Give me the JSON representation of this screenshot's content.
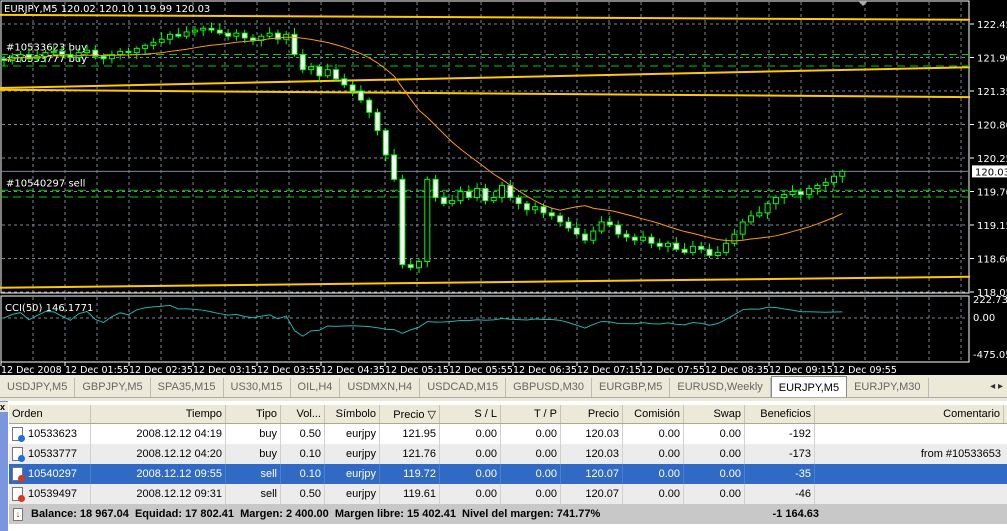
{
  "chart": {
    "title": "EURJPY,M5  120.02 120.10 119.99 120.03",
    "price_ticks": [
      "122.45",
      "121.90",
      "121.35",
      "120.80",
      "120.25",
      "119.70",
      "119.15",
      "118.60",
      "118.05"
    ],
    "current_price": "120.03",
    "time_labels": [
      "12 Dec 2008",
      "12 Dec 01:55",
      "12 Dec 02:35",
      "12 Dec 03:15",
      "12 Dec 03:55",
      "12 Dec 04:35",
      "12 Dec 05:15",
      "12 Dec 05:55",
      "12 Dec 06:35",
      "12 Dec 07:15",
      "12 Dec 07:55",
      "12 Dec 08:35",
      "12 Dec 09:15",
      "12 Dec 09:55"
    ],
    "closes": [
      121.85,
      121.9,
      121.95,
      121.88,
      121.92,
      121.98,
      122.0,
      121.95,
      121.9,
      121.98,
      122.02,
      121.92,
      121.88,
      121.95,
      122.0,
      121.98,
      122.05,
      122.1,
      122.15,
      122.2,
      122.28,
      122.25,
      122.32,
      122.35,
      122.38,
      122.35,
      122.3,
      122.25,
      122.3,
      122.22,
      122.18,
      122.25,
      122.3,
      122.2,
      122.28,
      121.95,
      121.7,
      121.75,
      121.6,
      121.7,
      121.55,
      121.45,
      121.35,
      121.2,
      121.0,
      120.7,
      120.3,
      119.9,
      118.5,
      118.45,
      118.55,
      119.9,
      119.6,
      119.5,
      119.55,
      119.7,
      119.6,
      119.75,
      119.55,
      119.6,
      119.8,
      119.6,
      119.5,
      119.4,
      119.45,
      119.35,
      119.3,
      119.2,
      119.1,
      119.0,
      118.9,
      119.05,
      119.2,
      119.15,
      119.0,
      118.95,
      118.9,
      118.95,
      118.85,
      118.8,
      118.85,
      118.75,
      118.7,
      118.8,
      118.75,
      118.65,
      118.7,
      118.85,
      119.0,
      119.2,
      119.3,
      119.35,
      119.5,
      119.6,
      119.65,
      119.7,
      119.65,
      119.75,
      119.8,
      119.85,
      119.95,
      120.03
    ],
    "trend_lines": [
      {
        "from": 122.6,
        "to": 122.52
      },
      {
        "from": 121.4,
        "to": 121.74
      },
      {
        "from": 121.37,
        "to": 121.25
      },
      {
        "from": 118.12,
        "to": 118.3
      }
    ],
    "order_lines": [
      {
        "price": 121.95,
        "label": "#10533623 buy"
      },
      {
        "price": 121.76,
        "label": "#10533777 buy"
      },
      {
        "price": 119.72,
        "label": "#10540297 sell"
      },
      {
        "price": 119.61,
        "label": ""
      }
    ],
    "indicator": {
      "label": "CCI(50) 146.1771",
      "max": "222.737",
      "zero": "0.00",
      "min": "-475.054"
    },
    "colors": {
      "candle": "#00ff00",
      "trend": "#ffc800",
      "ma": "#ff9900",
      "cci": "#20b2aa",
      "grid": "#778899"
    }
  },
  "tabs": [
    "USDJPY,M5",
    "GBPJPY,M5",
    "SPA35,M15",
    "US30,M15",
    "OIL,H4",
    "USDMXN,H4",
    "USDCAD,M15",
    "GBPUSD,M30",
    "EURGBP,M5",
    "EURUSD,Weekly",
    "EURJPY,M5",
    "EURJPY,M30"
  ],
  "active_tab": "EURJPY,M5",
  "terminal": {
    "close": "x",
    "headers": [
      "Orden",
      "Tiempo",
      "Tipo",
      "Vol...",
      "Símbolo",
      "Precio ▽",
      "S / L",
      "T / P",
      "Precio",
      "Comisión",
      "Swap",
      "Beneficios",
      "Comentario"
    ],
    "rows": [
      [
        "10533623",
        "2008.12.12 04:19",
        "buy",
        "0.50",
        "eurjpy",
        "121.95",
        "0.00",
        "0.00",
        "120.03",
        "0.00",
        "0.00",
        "-192",
        ""
      ],
      [
        "10533777",
        "2008.12.12 04:20",
        "buy",
        "0.10",
        "eurjpy",
        "121.76",
        "0.00",
        "0.00",
        "120.03",
        "0.00",
        "0.00",
        "-173",
        "from #10533653"
      ],
      [
        "10540297",
        "2008.12.12 09:55",
        "sell",
        "0.10",
        "eurjpy",
        "119.72",
        "0.00",
        "0.00",
        "120.07",
        "0.00",
        "0.00",
        "-35",
        ""
      ],
      [
        "10539497",
        "2008.12.12 09:31",
        "sell",
        "0.50",
        "eurjpy",
        "119.61",
        "0.00",
        "0.00",
        "120.07",
        "0.00",
        "0.00",
        "-46",
        ""
      ]
    ],
    "balance": "Balance: 18 967.04  Equidad: 17 802.41  Margen: 2 400.00  Margen libre: 15 402.41  Nivel del margen: 741.77%",
    "total_profit": "-1 164.63"
  }
}
